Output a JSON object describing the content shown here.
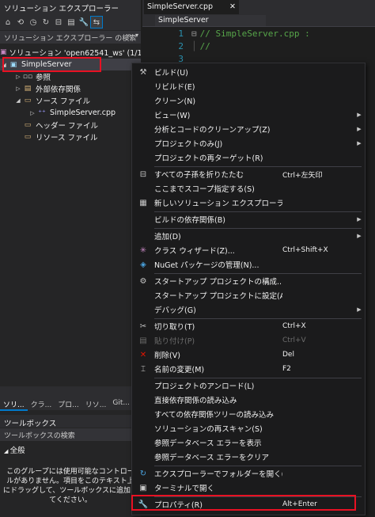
{
  "left_panel": {
    "title": "ソリューション エクスプローラー",
    "search_label": "ソリューション エクスプローラー の検索",
    "tree": [
      {
        "label": "ソリューション 'open62541_ws' (1/1 (",
        "indent": 0
      },
      {
        "label": "SimpleServer",
        "indent": 0
      },
      {
        "label": "参照",
        "indent": 1
      },
      {
        "label": "外部依存関係",
        "indent": 1
      },
      {
        "label": "ソース ファイル",
        "indent": 1
      },
      {
        "label": "SimpleServer.cpp",
        "indent": 2
      },
      {
        "label": "ヘッダー ファイル",
        "indent": 1
      },
      {
        "label": "リソース ファイル",
        "indent": 1
      }
    ],
    "bottom_tabs": [
      "ソリ...",
      "クラ...",
      "プロ...",
      "リソ...",
      "Git..."
    ],
    "toolbox": {
      "title": "ツールボックス",
      "search_label": "ツールボックスの検索",
      "group": "全般",
      "message": "このグループには使用可能なコントロールがありません。項目をこのテキスト上にドラッグして、ツールボックスに追加してください。"
    }
  },
  "editor": {
    "tab_label": "SimpleServer.cpp",
    "nav_label": "SimpleServer",
    "lines": [
      {
        "num": "1",
        "text": "// SimpleServer.cpp :"
      },
      {
        "num": "2",
        "text": "//"
      },
      {
        "num": "3",
        "text": ""
      }
    ]
  },
  "menu": {
    "items": [
      {
        "label": "ビルド(U)",
        "shortcut": "",
        "icon": "build-icon",
        "arrow": false
      },
      {
        "label": "リビルド(E)",
        "shortcut": "",
        "icon": "",
        "arrow": false
      },
      {
        "label": "クリーン(N)",
        "shortcut": "",
        "icon": "",
        "arrow": false
      },
      {
        "label": "ビュー(W)",
        "shortcut": "",
        "icon": "",
        "arrow": true
      },
      {
        "label": "分析とコードのクリーンアップ(Z)",
        "shortcut": "",
        "icon": "",
        "arrow": true
      },
      {
        "label": "プロジェクトのみ(J)",
        "shortcut": "",
        "icon": "",
        "arrow": true
      },
      {
        "label": "プロジェクトの再ターゲット(R)",
        "shortcut": "",
        "icon": "",
        "arrow": false
      },
      {
        "label": "すべての子孫を折りたたむ",
        "shortcut": "Ctrl+左矢印",
        "icon": "collapse-icon",
        "arrow": false
      },
      {
        "label": "ここまでスコープ指定する(S)",
        "shortcut": "",
        "icon": "",
        "arrow": false
      },
      {
        "label": "新しいソリューション エクスプローラーのビュー(N)",
        "shortcut": "",
        "icon": "new-view-icon",
        "arrow": false
      },
      {
        "label": "ビルドの依存関係(B)",
        "shortcut": "",
        "icon": "",
        "arrow": true
      },
      {
        "label": "追加(D)",
        "shortcut": "",
        "icon": "",
        "arrow": true
      },
      {
        "label": "クラス ウィザード(Z)...",
        "shortcut": "Ctrl+Shift+X",
        "icon": "class-wizard-icon",
        "arrow": false
      },
      {
        "label": "NuGet パッケージの管理(N)...",
        "shortcut": "",
        "icon": "nuget-icon",
        "arrow": false
      },
      {
        "label": "スタートアップ プロジェクトの構成...",
        "shortcut": "",
        "icon": "gear-icon",
        "arrow": false
      },
      {
        "label": "スタートアップ プロジェクトに設定(A)",
        "shortcut": "",
        "icon": "",
        "arrow": false
      },
      {
        "label": "デバッグ(G)",
        "shortcut": "",
        "icon": "",
        "arrow": true
      },
      {
        "label": "切り取り(T)",
        "shortcut": "Ctrl+X",
        "icon": "scissors-icon",
        "arrow": false
      },
      {
        "label": "貼り付け(P)",
        "shortcut": "Ctrl+V",
        "icon": "paste-icon",
        "arrow": false,
        "disabled": true
      },
      {
        "label": "削除(V)",
        "shortcut": "Del",
        "icon": "delete-icon",
        "arrow": false
      },
      {
        "label": "名前の変更(M)",
        "shortcut": "F2",
        "icon": "rename-icon",
        "arrow": false
      },
      {
        "label": "プロジェクトのアンロード(L)",
        "shortcut": "",
        "icon": "",
        "arrow": false
      },
      {
        "label": "直接依存関係の読み込み",
        "shortcut": "",
        "icon": "",
        "arrow": false
      },
      {
        "label": "すべての依存関係ツリーの読み込み",
        "shortcut": "",
        "icon": "",
        "arrow": false
      },
      {
        "label": "ソリューションの再スキャン(S)",
        "shortcut": "",
        "icon": "",
        "arrow": false
      },
      {
        "label": "参照データベース エラーを表示",
        "shortcut": "",
        "icon": "",
        "arrow": false
      },
      {
        "label": "参照データベース エラーをクリア",
        "shortcut": "",
        "icon": "",
        "arrow": false
      },
      {
        "label": "エクスプローラーでフォルダーを開く(X)",
        "shortcut": "",
        "icon": "open-folder-icon",
        "arrow": false
      },
      {
        "label": "ターミナルで開く",
        "shortcut": "",
        "icon": "terminal-icon",
        "arrow": false
      },
      {
        "label": "プロパティ(R)",
        "shortcut": "Alt+Enter",
        "icon": "wrench-icon",
        "arrow": false
      }
    ]
  },
  "colors": {
    "highlight_red": "#e81123",
    "accent_blue": "#007acc",
    "comment_green": "#57a64a",
    "line_number_blue": "#2b91af"
  }
}
